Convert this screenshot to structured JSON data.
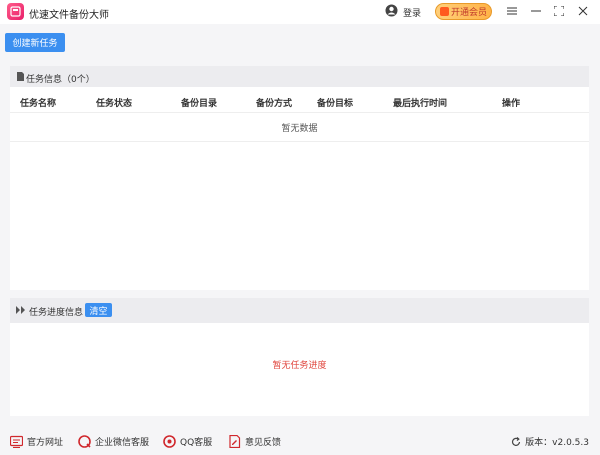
{
  "app": {
    "title": "优速文件备份大师",
    "login_label": "登录",
    "vip_label": "开通会员"
  },
  "toolbar": {
    "create_label": "创建新任务"
  },
  "task_panel": {
    "title": "任务信息（0个）",
    "columns": [
      "任务名称",
      "任务状态",
      "备份目录",
      "备份方式",
      "备份目标",
      "最后执行时间",
      "操作"
    ],
    "empty_text": "暂无数据"
  },
  "progress_panel": {
    "title": "任务进度信息",
    "clear_label": "清空",
    "empty_text": "暂无任务进度"
  },
  "footer": {
    "links": [
      "官方网址",
      "企业微信客服",
      "QQ客服",
      "意见反馈"
    ],
    "version": "版本：v2.0.5.3"
  },
  "colors": {
    "accent": "#3b8ff0",
    "empty_progress": "#e0463e",
    "vip_bg": "#ffb347"
  }
}
